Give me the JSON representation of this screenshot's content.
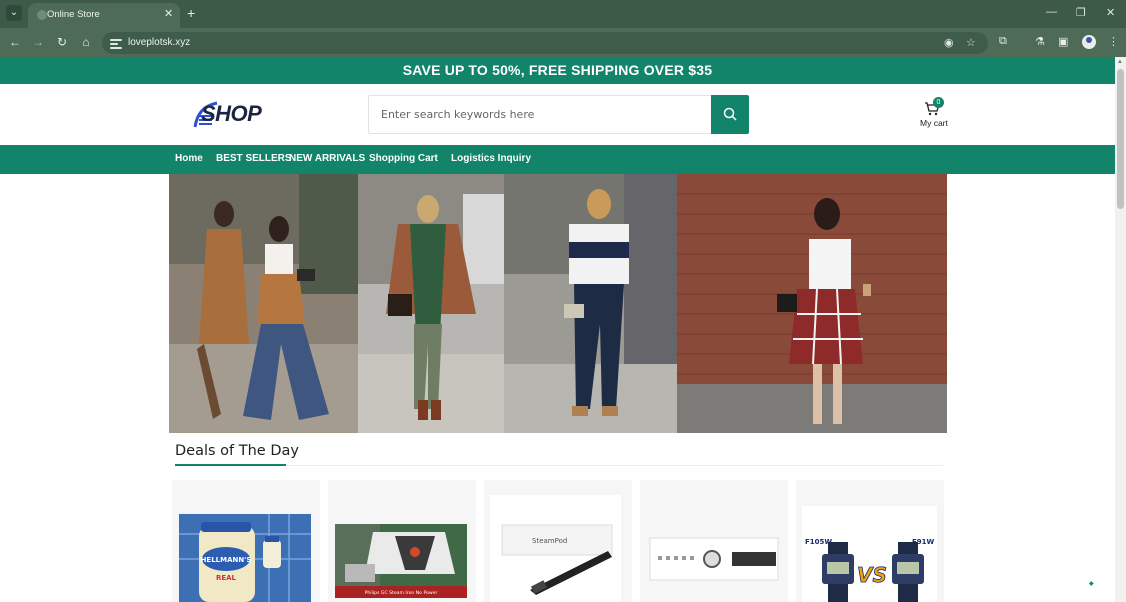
{
  "browser": {
    "tab_title": "Online Store",
    "url": "loveplotsk.xyz",
    "icons": {
      "tab_list": "chevron-down-icon",
      "close_tab": "close-icon",
      "new_tab": "plus-icon",
      "back": "arrow-left-icon",
      "forward": "arrow-right-icon",
      "reload": "reload-icon",
      "home": "home-icon",
      "eye_off": "eye-off-icon",
      "bookmark": "star-icon",
      "extensions": "puzzle-icon",
      "labs": "flask-icon",
      "side_panel": "side-panel-icon",
      "profile": "profile-icon",
      "menu": "more-vert-icon",
      "minimize": "minimize-icon",
      "restore": "restore-icon",
      "close_window": "close-icon"
    }
  },
  "promo": {
    "text": "SAVE UP TO 50%, FREE SHIPPING OVER $35"
  },
  "header": {
    "logo_text": "SHOP",
    "search_placeholder": "Enter search keywords here",
    "cart_count": "0",
    "cart_label": "My cart"
  },
  "nav": {
    "items": [
      "Home",
      "BEST SELLERS",
      "NEW ARRIVALS",
      "Shopping Cart",
      "Logistics Inquiry"
    ]
  },
  "deals": {
    "title": "Deals of The Day",
    "products": [
      {
        "image_label": "HELLMANN'S",
        "image_sublabel": "REAL"
      },
      {
        "image_label": "Philips GC Steam Iron  No Power"
      },
      {
        "image_label": "SteamPod"
      },
      {
        "image_label": ""
      },
      {
        "image_label_left": "F105W",
        "image_label_right": "F91W",
        "image_label_vs": "VS"
      }
    ]
  },
  "colors": {
    "brand_green": "#12846a",
    "browser_frame": "#3c5a47",
    "toolbar": "#4d6b57"
  }
}
